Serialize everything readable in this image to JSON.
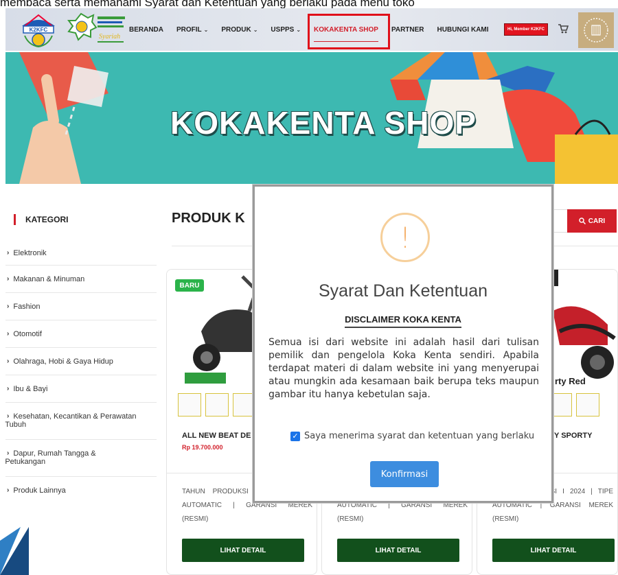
{
  "caption": "membaca serta memahami Syarat dan Ketentuan yang berlaku pada menu toko",
  "nav": {
    "logo1_text": "K2KFC",
    "items": [
      {
        "label": "BERANDA",
        "dropdown": false
      },
      {
        "label": "PROFIL",
        "dropdown": true
      },
      {
        "label": "PRODUK",
        "dropdown": true
      },
      {
        "label": "USPPS",
        "dropdown": true
      },
      {
        "label": "KOKAKENTA SHOP",
        "dropdown": false,
        "active": true
      },
      {
        "label": "PARTNER",
        "dropdown": false
      },
      {
        "label": "HUBUNGI KAMI",
        "dropdown": false
      }
    ],
    "member_label": "Hi, Member K2KFC",
    "highlight_color": "#e0101a",
    "accent_color": "#d21f2a"
  },
  "banner": {
    "title": "KOKAKENTA SHOP",
    "bg_color": "#3ab7b0"
  },
  "sidebar": {
    "heading": "KATEGORI",
    "categories": [
      "Elektronik",
      "Makanan & Minuman",
      "Fashion",
      "Otomotif",
      "Olahraga, Hobi & Gaya Hidup",
      "Ibu & Bayi",
      "Kesehatan, Kecantikan & Perawatan Tubuh",
      "Dapur, Rumah Tangga & Petukangan",
      "Produk Lainnya"
    ]
  },
  "main": {
    "title": "PRODUK K",
    "search_button": "CARI",
    "cards": [
      {
        "badge": "BARU",
        "name": "ALL NEW BEAT DE",
        "price": "Rp 19.700.000",
        "spec": "TAHUN PRODUKSI I 2024 | TIPE AUTOMATIC | GARANSI MEREK (RESMI)",
        "button": "LIHAT DETAIL"
      },
      {
        "badge": "",
        "name": "",
        "price": "",
        "spec": "TAHUN PRODUKSI I 2024 | TIPE AUTOMATIC | GARANSI MEREK (RESMI)",
        "button": "LIHAT DETAIL"
      },
      {
        "badge": "",
        "name": "Y SPORTY",
        "title_partial": "rty Red",
        "price": "",
        "spec": "TAHUN PRODUKSI I 2024 | TIPE AUTOMATIC | GARANSI MEREK (RESMI)",
        "button": "LIHAT DETAIL"
      }
    ]
  },
  "modal": {
    "title": "Syarat Dan Ketentuan",
    "subtitle": "DISCLAIMER KOKA KENTA",
    "body": "Semua isi dari website ini adalah hasil dari tulisan pemilik dan pengelola Koka Kenta sendiri. Apabila terdapat materi di dalam website ini yang menyerupai atau mungkin ada kesamaan baik berupa teks maupun gambar itu hanya kebetulan saja.",
    "checkbox_label": "Saya menerima syarat dan ketentuan yang berlaku",
    "checkbox_checked": true,
    "confirm_label": "Konfirmasi",
    "warning_glyph": "!",
    "confirm_color": "#3d8ddf"
  }
}
